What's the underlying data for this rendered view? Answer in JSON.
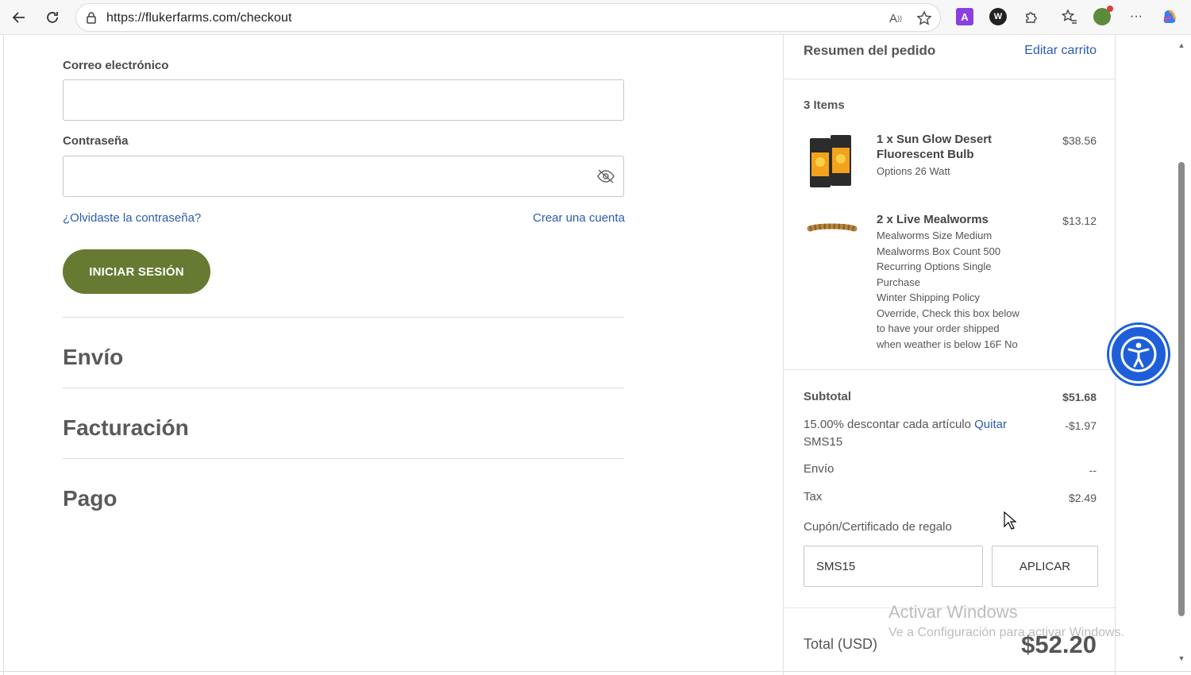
{
  "browser": {
    "url": "https://flukerfarms.com/checkout",
    "read_aloud_label": "A",
    "ext_label_a": "A"
  },
  "login": {
    "email_label": "Correo electrónico",
    "password_label": "Contraseña",
    "forgot_link": "¿Olvidaste la contraseña?",
    "create_account_link": "Crear una cuenta",
    "login_button": "INICIAR SESIÓN"
  },
  "sections": {
    "shipping": "Envío",
    "billing": "Facturación",
    "payment": "Pago"
  },
  "summary": {
    "title": "Resumen del pedido",
    "edit_cart": "Editar carrito",
    "items_count": "3 Items",
    "items": [
      {
        "name": "1 x Sun Glow Desert Fluorescent Bulb",
        "options": "Options 26 Watt",
        "price": "$38.56"
      },
      {
        "name": "2 x Live Mealworms",
        "options": "Mealworms Size Medium\nMealworms Box Count 500\nRecurring Options Single Purchase\nWinter Shipping Policy Override, Check this box below to have your order shipped when weather is below 16F No",
        "price": "$13.12"
      }
    ],
    "subtotal_label": "Subtotal",
    "subtotal_value": "$51.68",
    "discount_label": "15.00% descontar cada artículo",
    "discount_remove": "Quitar",
    "discount_code": "SMS15",
    "discount_value": "-$1.97",
    "shipping_label": "Envío",
    "shipping_value": "--",
    "tax_label": "Tax",
    "tax_value": "$2.49",
    "coupon_label": "Cupón/Certificado de regalo",
    "coupon_value": "SMS15",
    "apply_button": "APLICAR",
    "total_label": "Total (USD)",
    "total_value": "$52.20"
  },
  "watermark": {
    "line1": "Activar Windows",
    "line2": "Ve a Configuración para activar Windows."
  },
  "colors": {
    "brand_green": "#667a32",
    "link_blue": "#2a5bb5",
    "a11y_blue": "#1e5fd9"
  }
}
